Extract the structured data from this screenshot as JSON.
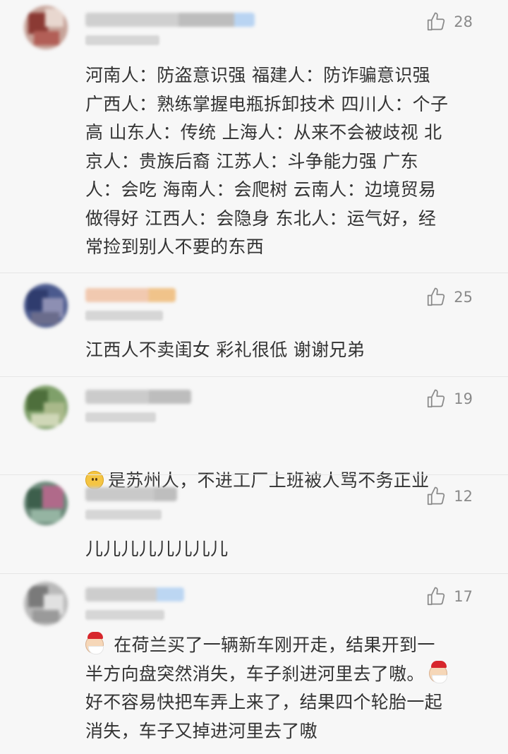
{
  "colors": {
    "background": "#f7f7f7",
    "text": "#333333",
    "like_gray": "#8a8a8a",
    "divider": "#e6e6e6"
  },
  "comments": [
    {
      "likes": "28",
      "text": "河南人：防盗意识强  福建人：防诈骗意识强\n广西人：熟练掌握电瓶拆卸技术 四川人：个子\n高  山东人：传统  上海人：从来不会被歧视 北\n京人：贵族后裔  江苏人：斗争能力强  广东\n人：会吃  海南人：会爬树  云南人：边境贸易\n做得好  江西人：会隐身  东北人：运气好，经\n常捡到别人不要的东西",
      "avatar_icon": "user-avatar-icon"
    },
    {
      "likes": "25",
      "text": "江西人不卖闺女 彩礼很低 谢谢兄弟",
      "avatar_icon": "user-avatar-icon"
    },
    {
      "likes": "19",
      "emoji": "face-emoji-icon",
      "text": "是苏州人，不进工厂上班被人骂不务正业",
      "avatar_icon": "user-avatar-icon"
    },
    {
      "likes": "12",
      "text": "儿儿儿儿儿儿儿儿",
      "avatar_icon": "user-avatar-icon"
    },
    {
      "likes": "17",
      "emoji": "santa-emoji-icon",
      "text_part1": " 在荷兰买了一辆新车刚开走，结果开到一\n半方向盘突然消失，车子刹进河里去了嗷。",
      "text_part2": "\n好不容易快把车弄上来了，结果四个轮胎一起\n消失，车子又掉进河里去了嗷",
      "avatar_icon": "user-avatar-icon"
    }
  ]
}
